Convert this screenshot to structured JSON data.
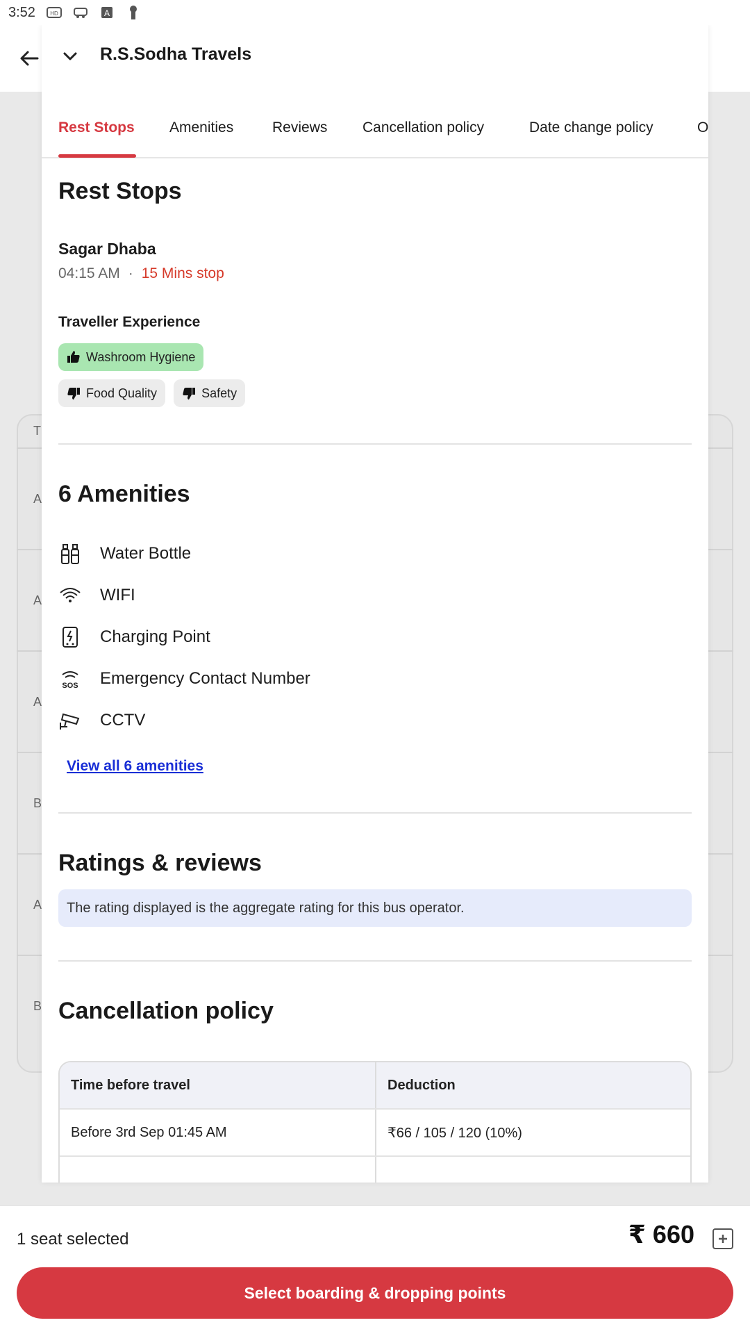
{
  "status_bar": {
    "time": "3:52"
  },
  "sheet": {
    "title": "R.S.Sodha Travels",
    "tabs": [
      {
        "label": "Rest Stops",
        "active": true
      },
      {
        "label": "Amenities"
      },
      {
        "label": "Reviews"
      },
      {
        "label": "Cancellation policy"
      },
      {
        "label": "Date change policy"
      },
      {
        "label": "O"
      }
    ],
    "rest_stops": {
      "heading": "Rest Stops",
      "stop_name": "Sagar Dhaba",
      "time": "04:15 AM",
      "separator": "·",
      "duration": "15 Mins stop",
      "experience_title": "Traveller Experience",
      "chips": [
        {
          "label": "Washroom Hygiene",
          "sentiment": "positive",
          "icon": "thumbs-up-icon"
        },
        {
          "label": "Food Quality",
          "sentiment": "negative",
          "icon": "thumbs-down-icon"
        },
        {
          "label": "Safety",
          "sentiment": "negative",
          "icon": "thumbs-down-icon"
        }
      ]
    },
    "amenities": {
      "heading": "6 Amenities",
      "items": [
        {
          "label": "Water Bottle",
          "icon": "water-bottle-icon"
        },
        {
          "label": "WIFI",
          "icon": "wifi-icon"
        },
        {
          "label": "Charging Point",
          "icon": "charging-point-icon"
        },
        {
          "label": "Emergency Contact Number",
          "icon": "sos-icon"
        },
        {
          "label": "CCTV",
          "icon": "cctv-icon"
        }
      ],
      "view_all": "View all 6 amenities"
    },
    "ratings": {
      "heading": "Ratings & reviews",
      "note": "The rating displayed is the aggregate rating for this bus operator."
    },
    "cancellation": {
      "heading": "Cancellation policy",
      "columns": [
        "Time before travel",
        "Deduction"
      ],
      "rows": [
        [
          "Before 3rd Sep 01:45 AM",
          "₹66 / 105 / 120 (10%)"
        ]
      ]
    }
  },
  "background": {
    "row_letters": [
      "T",
      "A",
      "A",
      "A",
      "B",
      "A",
      "B"
    ]
  },
  "bottom_bar": {
    "seat_text": "1 seat selected",
    "price": "₹ 660",
    "cta": "Select boarding & dropping points"
  },
  "colors": {
    "accent": "#d63941",
    "positive_chip": "#a9e6b1",
    "link": "#1a2fd6",
    "note_bg": "#e6ebfb"
  }
}
